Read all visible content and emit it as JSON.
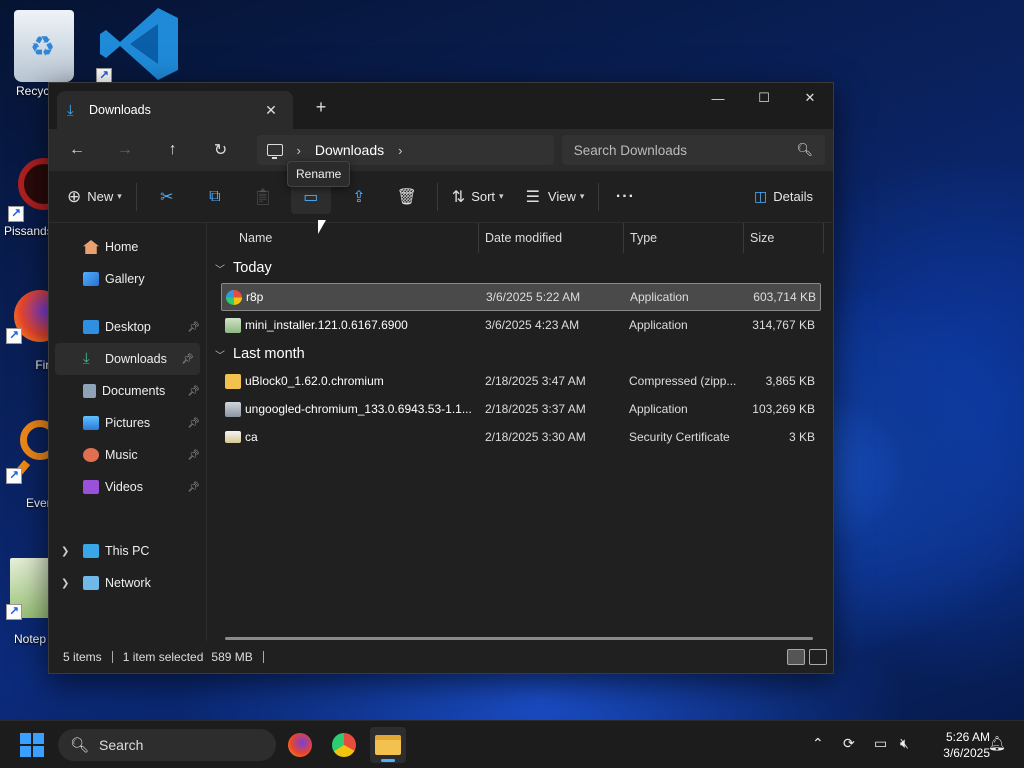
{
  "desktop": {
    "icons": [
      {
        "label": "Recycl",
        "icon": "recycle-bin-icon"
      },
      {
        "label": "Pissands",
        "icon": "app-icon"
      },
      {
        "label": "Fire",
        "icon": "firefox-icon"
      },
      {
        "label": "Everyt",
        "icon": "search-icon"
      },
      {
        "label": "Notep",
        "icon": "notepad-icon"
      }
    ]
  },
  "window": {
    "tab_title": "Downloads",
    "new_tab": "+",
    "breadcrumb": [
      "Downloads"
    ],
    "search_placeholder": "Search Downloads",
    "toolbar": {
      "new_label": "New",
      "sort_label": "Sort",
      "view_label": "View",
      "more_label": "···",
      "details_label": "Details",
      "tooltip": "Rename"
    },
    "sidebar": [
      {
        "label": "Home"
      },
      {
        "label": "Gallery"
      },
      {
        "label": "Desktop"
      },
      {
        "label": "Downloads"
      },
      {
        "label": "Documents"
      },
      {
        "label": "Pictures"
      },
      {
        "label": "Music"
      },
      {
        "label": "Videos"
      },
      {
        "label": "This PC"
      },
      {
        "label": "Network"
      }
    ],
    "columns": {
      "name": "Name",
      "date": "Date modified",
      "type": "Type",
      "size": "Size"
    },
    "groups": [
      {
        "label": "Today",
        "files": [
          {
            "name": "r8p",
            "date": "3/6/2025 5:22 AM",
            "type": "Application",
            "size": "603,714 KB"
          },
          {
            "name": "mini_installer.121.0.6167.6900",
            "date": "3/6/2025 4:23 AM",
            "type": "Application",
            "size": "314,767 KB"
          }
        ]
      },
      {
        "label": "Last month",
        "files": [
          {
            "name": "uBlock0_1.62.0.chromium",
            "date": "2/18/2025 3:47 AM",
            "type": "Compressed (zipp...",
            "size": "3,865 KB"
          },
          {
            "name": "ungoogled-chromium_133.0.6943.53-1.1...",
            "date": "2/18/2025 3:37 AM",
            "type": "Application",
            "size": "103,269 KB"
          },
          {
            "name": "ca",
            "date": "2/18/2025 3:30 AM",
            "type": "Security Certificate",
            "size": "3 KB"
          }
        ]
      }
    ],
    "status": {
      "items": "5 items",
      "selected": "1 item selected",
      "size": "589 MB"
    }
  },
  "taskbar": {
    "search_label": "Search",
    "time": "5:26 AM",
    "date": "3/6/2025"
  },
  "colors": {
    "accent": "#4fb0ff",
    "folder": "#f2c14e"
  }
}
